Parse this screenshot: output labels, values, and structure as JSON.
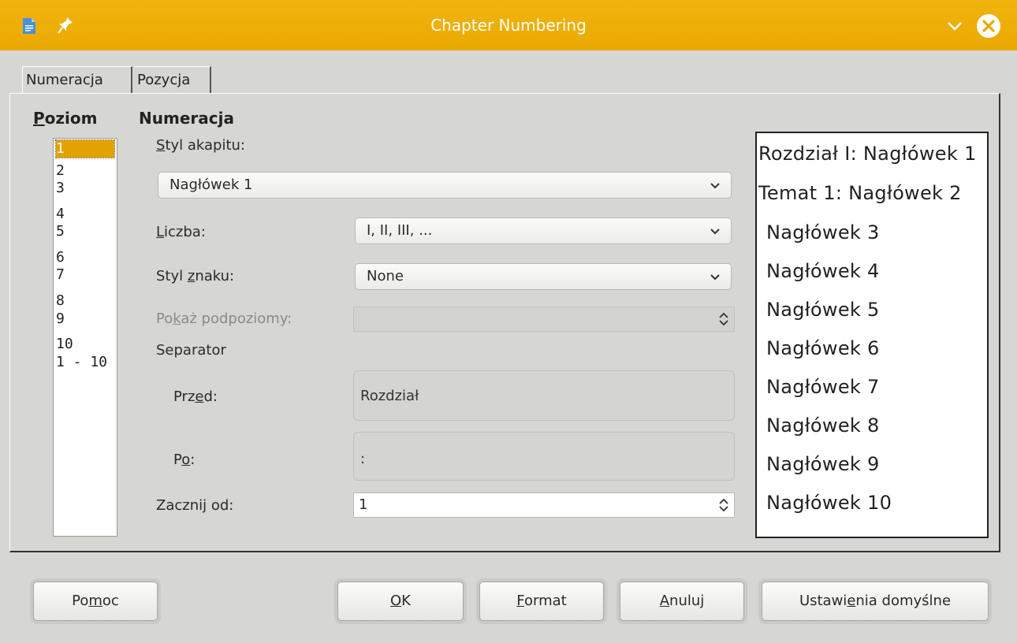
{
  "window": {
    "title": "Chapter Numbering"
  },
  "tabs": [
    {
      "label": "Numeracja"
    },
    {
      "label": "Pozycja"
    }
  ],
  "level": {
    "header_accel": "P",
    "header_rest": "oziom",
    "items": [
      "1",
      "2",
      "3",
      "4",
      "5",
      "6",
      "7",
      "8",
      "9",
      "10",
      "1 - 10"
    ],
    "selected": "1"
  },
  "numbering": {
    "header": "Numeracja",
    "paragraph_style": {
      "label_accel": "S",
      "label_rest": "tyl akapitu:",
      "value": "Nagłówek 1"
    },
    "number": {
      "label_accel": "L",
      "label_rest": "iczba:",
      "value": "I, II, III, ..."
    },
    "char_style": {
      "label_pre": "Styl ",
      "label_accel": "z",
      "label_rest": "naku:",
      "value": "None"
    },
    "show_sublevels": {
      "label_pre": "Po",
      "label_accel": "k",
      "label_rest": "aż podpoziomy:",
      "value": ""
    },
    "separator": {
      "label": "Separator"
    },
    "before": {
      "label_pre": "Prz",
      "label_accel": "e",
      "label_rest": "d:",
      "value": "Rozdział"
    },
    "after": {
      "label_pre": "P",
      "label_accel": "o",
      "label_rest": ":",
      "value": ":"
    },
    "start_at": {
      "label_pre": "Zaczni",
      "label_accel": "j",
      "label_rest": " od:",
      "value": "1"
    }
  },
  "preview": {
    "lines": [
      "Rozdział I: Nagłówek 1",
      "Temat 1: Nagłówek 2",
      "Nagłówek 3",
      "Nagłówek 4",
      "Nagłówek 5",
      "Nagłówek 6",
      "Nagłówek 7",
      "Nagłówek 8",
      "Nagłówek 9",
      "Nagłówek 10"
    ]
  },
  "buttons": {
    "help": {
      "pre": "Po",
      "accel": "m",
      "rest": "oc"
    },
    "ok": {
      "pre": "",
      "accel": "O",
      "rest": "K"
    },
    "format": {
      "pre": "",
      "accel": "F",
      "rest": "ormat"
    },
    "cancel": {
      "pre": "",
      "accel": "A",
      "rest": "nuluj"
    },
    "reset": {
      "pre": "Ustawi",
      "accel": "e",
      "rest": "nia domyślne"
    }
  },
  "colors": {
    "titlebar": "#eaa900",
    "selection": "#e2a200",
    "background": "#d6d6d2"
  }
}
